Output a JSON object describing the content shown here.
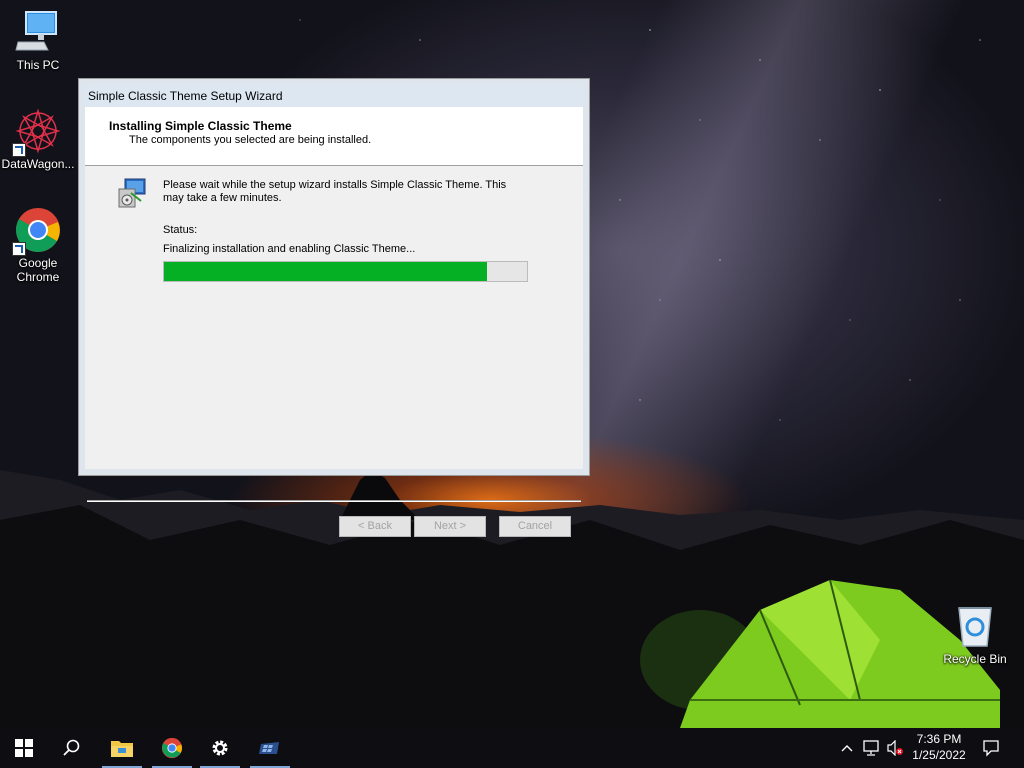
{
  "desktop": {
    "icons": [
      {
        "label": "This PC",
        "icon": "computer-icon"
      },
      {
        "label": "DataWagon...",
        "icon": "datawagon-icon"
      },
      {
        "label": "Google Chrome",
        "icon": "chrome-icon"
      },
      {
        "label": "Recycle Bin",
        "icon": "recycle-bin-icon"
      }
    ]
  },
  "wizard": {
    "title": "Simple Classic Theme Setup Wizard",
    "header_title": "Installing Simple Classic Theme",
    "header_subtitle": "The components you selected are being installed.",
    "description": "Please wait while the setup wizard installs Simple Classic Theme. This may take a few minutes.",
    "status_label": "Status:",
    "status_text": "Finalizing installation and enabling Classic Theme...",
    "progress_fraction": 0.89,
    "progress_color": "#06b025",
    "buttons": {
      "back": "< Back",
      "next": "Next >",
      "cancel": "Cancel"
    }
  },
  "taskbar": {
    "items": [
      "start-icon",
      "search-icon",
      "file-explorer-icon",
      "chrome-icon",
      "settings-icon",
      "installer-icon"
    ],
    "tray": [
      "show-hidden-icons-icon",
      "network-icon",
      "volume-muted-icon"
    ],
    "time": "7:36 PM",
    "date": "1/25/2022",
    "notifications": "action-center-icon"
  }
}
